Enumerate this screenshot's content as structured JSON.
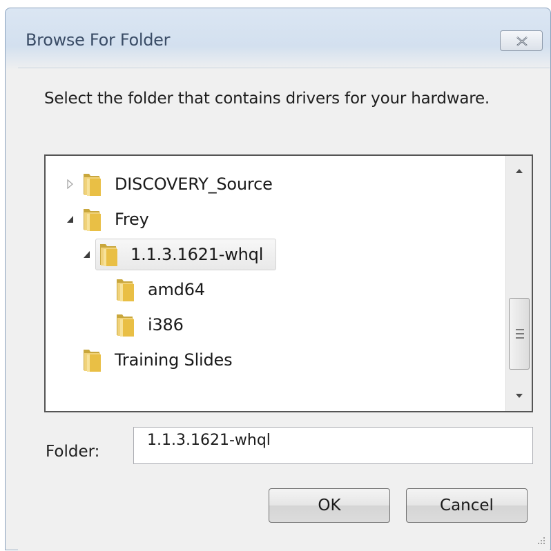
{
  "window": {
    "title": "Browse For Folder",
    "close_icon": "close-icon"
  },
  "instruction": "Select the folder that contains drivers for your hardware.",
  "tree": {
    "items": [
      {
        "label": "DISCOVERY_Source",
        "level": 0,
        "expander": "collapsed",
        "icon": "folder-icon"
      },
      {
        "label": "Frey",
        "level": 0,
        "expander": "expanded",
        "icon": "folder-icon"
      },
      {
        "label": "1.1.3.1621-whql",
        "level": 1,
        "expander": "expanded",
        "icon": "folder-icon",
        "selected": true
      },
      {
        "label": "amd64",
        "level": 2,
        "expander": "none",
        "icon": "folder-icon"
      },
      {
        "label": "i386",
        "level": 2,
        "expander": "none",
        "icon": "folder-icon"
      },
      {
        "label": "Training Slides",
        "level": 0,
        "expander": "none",
        "icon": "folder-icon"
      }
    ],
    "scroll_position": 0.55
  },
  "folder": {
    "label": "Folder:",
    "value": "1.1.3.1621-whql"
  },
  "buttons": {
    "ok": "OK",
    "cancel": "Cancel"
  },
  "colors": {
    "title_text": "#3a4c66",
    "folder_yellow": "#e8c04a",
    "tree_border": "#555555"
  }
}
